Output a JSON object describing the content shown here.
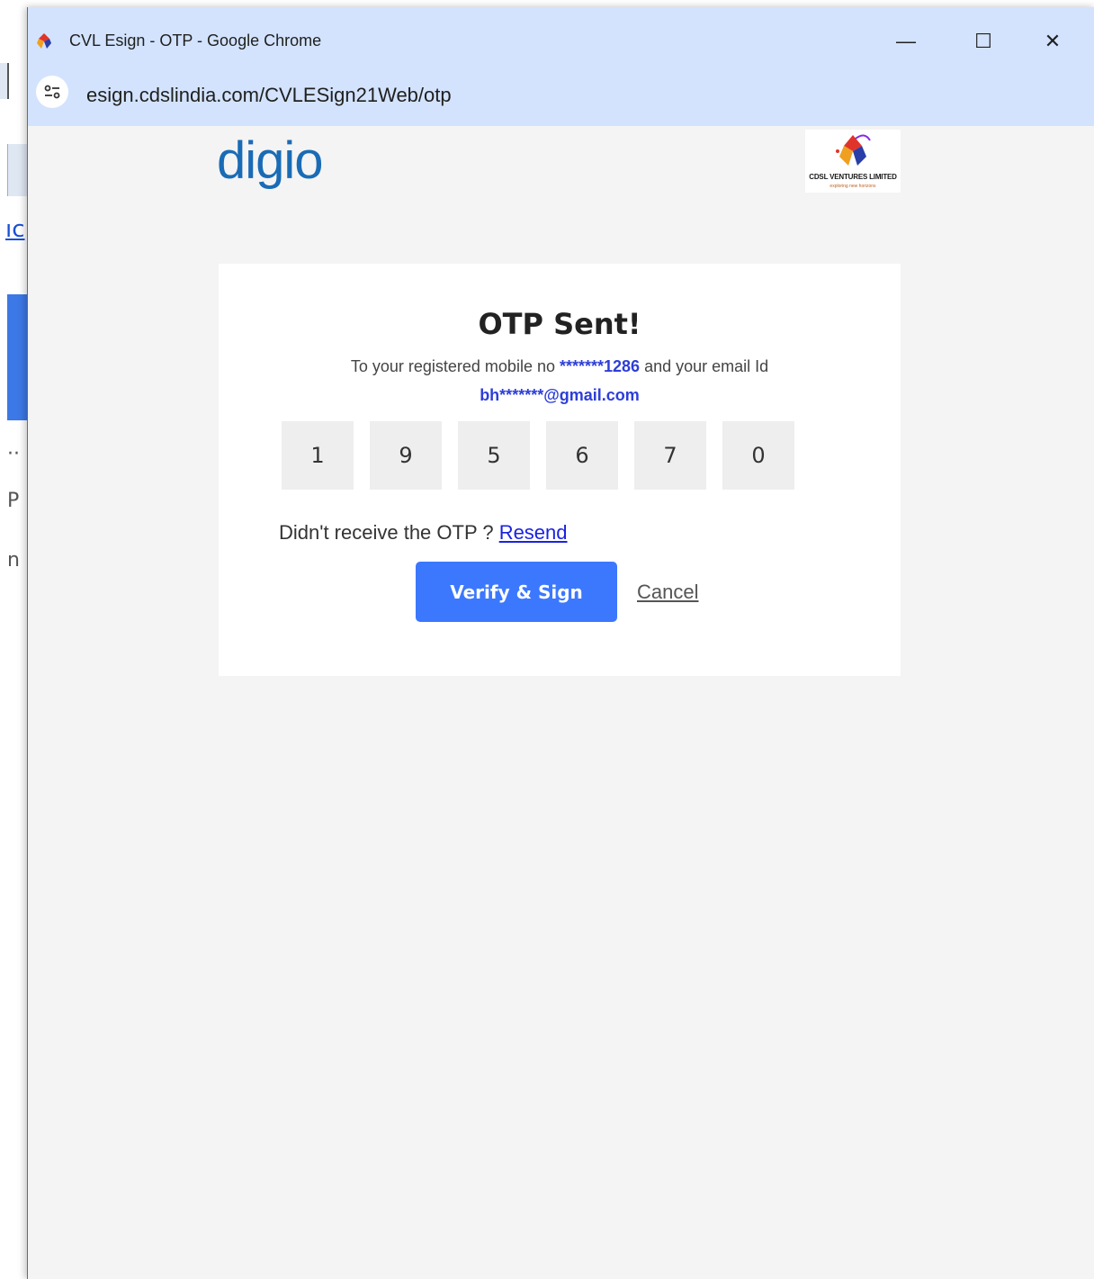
{
  "window": {
    "title": "CVL Esign - OTP - Google Chrome",
    "url": "esign.cdslindia.com/CVLESign21Web/otp",
    "minimize": "—",
    "maximize": "☐",
    "close": "✕"
  },
  "background_window": {
    "fragments": [
      "ıc",
      "··",
      "P",
      "n"
    ]
  },
  "header": {
    "digio_logo": "digio",
    "cdsl_logo_name": "CDSL VENTURES LIMITED",
    "cdsl_logo_tagline": "exploring new horizons"
  },
  "otp_card": {
    "title": "OTP Sent!",
    "desc_prefix": "To your registered mobile no ",
    "masked_mobile": "*******1286",
    "desc_middle": " and your email Id",
    "masked_email": "bh*******@gmail.com",
    "digits": [
      "1",
      "9",
      "5",
      "6",
      "7",
      "0"
    ],
    "resend_prompt": "Didn't receive the OTP ? ",
    "resend_label": "Resend",
    "verify_label": "Verify & Sign",
    "cancel_label": "Cancel"
  },
  "colors": {
    "titlebar": "#d3e3fd",
    "primary_button": "#3c78fe",
    "digio_blue": "#1a6bb5",
    "highlight_text": "#2d3ed8"
  }
}
